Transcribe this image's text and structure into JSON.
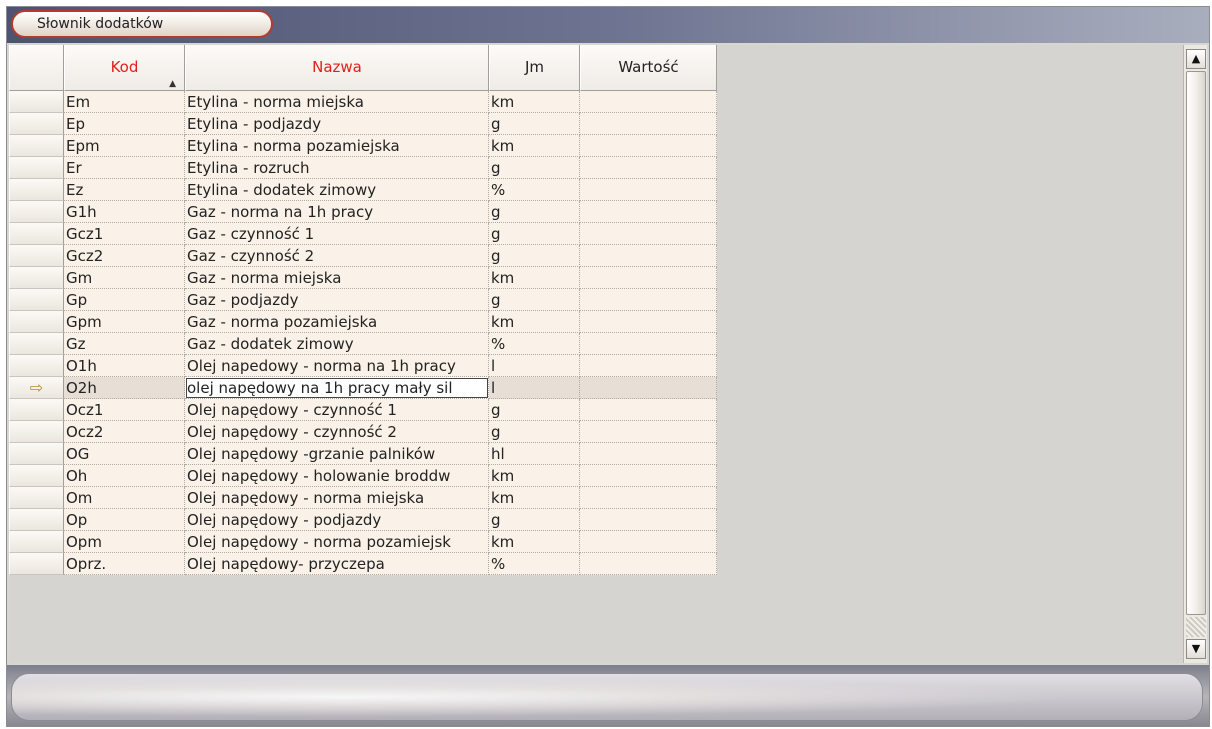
{
  "window": {
    "title": "Słownik dodatków"
  },
  "grid": {
    "headers": {
      "kod": "Kod",
      "nazwa": "Nazwa",
      "jm": "Jm",
      "wartosc": "Wartość"
    },
    "sort_indicator": "▲",
    "current_row_indicator": "⇨",
    "rows": [
      {
        "kod": "Em",
        "nazwa": "Etylina - norma miejska",
        "jm": "km",
        "wartosc": ""
      },
      {
        "kod": "Ep",
        "nazwa": "Etylina - podjazdy",
        "jm": "g",
        "wartosc": ""
      },
      {
        "kod": "Epm",
        "nazwa": "Etylina - norma pozamiejska",
        "jm": "km",
        "wartosc": ""
      },
      {
        "kod": "Er",
        "nazwa": "Etylina - rozruch",
        "jm": "g",
        "wartosc": ""
      },
      {
        "kod": "Ez",
        "nazwa": "Etylina - dodatek zimowy",
        "jm": "%",
        "wartosc": ""
      },
      {
        "kod": "G1h",
        "nazwa": "Gaz - norma na 1h pracy",
        "jm": "g",
        "wartosc": ""
      },
      {
        "kod": "Gcz1",
        "nazwa": "Gaz - czynność 1",
        "jm": "g",
        "wartosc": ""
      },
      {
        "kod": "Gcz2",
        "nazwa": "Gaz - czynność 2",
        "jm": "g",
        "wartosc": ""
      },
      {
        "kod": "Gm",
        "nazwa": "Gaz - norma miejska",
        "jm": "km",
        "wartosc": ""
      },
      {
        "kod": "Gp",
        "nazwa": "Gaz - podjazdy",
        "jm": "g",
        "wartosc": ""
      },
      {
        "kod": "Gpm",
        "nazwa": "Gaz - norma pozamiejska",
        "jm": "km",
        "wartosc": ""
      },
      {
        "kod": "Gz",
        "nazwa": "Gaz - dodatek zimowy",
        "jm": "%",
        "wartosc": ""
      },
      {
        "kod": "O1h",
        "nazwa": "Olej napedowy - norma na 1h pracy",
        "jm": "l",
        "wartosc": ""
      },
      {
        "kod": "O2h",
        "nazwa": "olej napędowy na 1h pracy mały sil",
        "jm": "l",
        "wartosc": ""
      },
      {
        "kod": "Ocz1",
        "nazwa": "Olej napędowy - czynność 1",
        "jm": "g",
        "wartosc": ""
      },
      {
        "kod": "Ocz2",
        "nazwa": "Olej napędowy - czynność 2",
        "jm": "g",
        "wartosc": ""
      },
      {
        "kod": "OG",
        "nazwa": "Olej napędowy -grzanie palników",
        "jm": "hl",
        "wartosc": ""
      },
      {
        "kod": "Oh",
        "nazwa": "Olej napędowy - holowanie broddw",
        "jm": "km",
        "wartosc": ""
      },
      {
        "kod": "Om",
        "nazwa": "Olej napędowy - norma miejska",
        "jm": "km",
        "wartosc": ""
      },
      {
        "kod": "Op",
        "nazwa": "Olej napędowy - podjazdy",
        "jm": "g",
        "wartosc": ""
      },
      {
        "kod": "Opm",
        "nazwa": "Olej napędowy - norma pozamiejsk",
        "jm": "km",
        "wartosc": ""
      },
      {
        "kod": "Oprz.",
        "nazwa": "Olej napędowy- przyczepa",
        "jm": "%",
        "wartosc": ""
      }
    ],
    "current_row": 13
  },
  "scrollbar": {
    "up_icon": "▲",
    "down_icon": "▼"
  },
  "colors": {
    "header_text": "#e0201a",
    "title_accent": "#b53a2c"
  }
}
